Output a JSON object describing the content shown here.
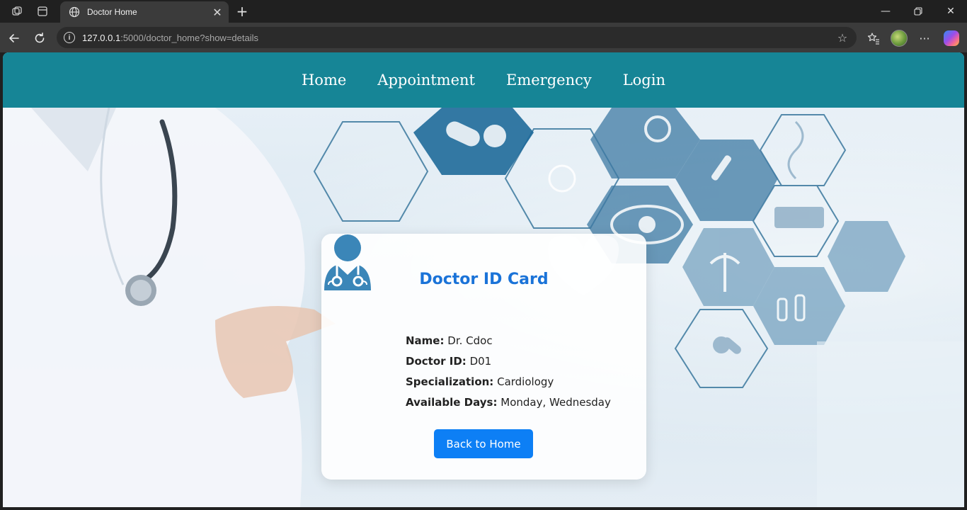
{
  "browser": {
    "tab_title": "Doctor Home",
    "url_host": "127.0.0.1",
    "url_rest": ":5000/doctor_home?show=details"
  },
  "navbar": {
    "items": [
      {
        "label": "Home"
      },
      {
        "label": "Appointment"
      },
      {
        "label": "Emergency"
      },
      {
        "label": "Login"
      }
    ]
  },
  "card": {
    "title": "Doctor ID Card",
    "fields": [
      {
        "label": "Name:",
        "value": "Dr. Cdoc"
      },
      {
        "label": "Doctor ID:",
        "value": "D01"
      },
      {
        "label": "Specialization:",
        "value": "Cardiology"
      },
      {
        "label": "Available Days:",
        "value": "Monday, Wednesday"
      }
    ],
    "back_button": "Back to Home"
  },
  "colors": {
    "navbar": "#168596",
    "title": "#1a73d8",
    "button": "#0d7ff5",
    "doctor_icon": "#3b86b8"
  },
  "icons": [
    "workspaces-icon",
    "tab-actions-icon",
    "globe-icon",
    "close-icon",
    "new-tab-icon",
    "minimize-icon",
    "restore-icon",
    "window-close-icon",
    "back-arrow-icon",
    "reload-icon",
    "site-info-icon",
    "favorite-star-icon",
    "favorites-icon",
    "profile-avatar-icon",
    "more-options-icon",
    "copilot-icon",
    "doctor-icon"
  ]
}
